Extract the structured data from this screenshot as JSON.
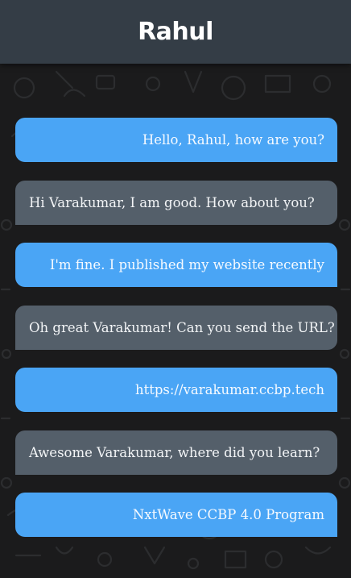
{
  "header": {
    "title": "Rahul"
  },
  "messages": [
    {
      "side": "sent",
      "text": "Hello, Rahul, how are you?"
    },
    {
      "side": "received",
      "text": "Hi Varakumar, I am good. How about you?"
    },
    {
      "side": "sent",
      "text": "I'm fine. I published my website recently"
    },
    {
      "side": "received",
      "text": "Oh great Varakumar! Can you send the URL?"
    },
    {
      "side": "sent",
      "text": "https://varakumar.ccbp.tech"
    },
    {
      "side": "received",
      "text": "Awesome Varakumar, where did you learn?"
    },
    {
      "side": "sent",
      "text": "NxtWave CCBP 4.0 Program"
    }
  ],
  "colors": {
    "header_bg": "#343d46",
    "sent_bubble": "#4aa5f5",
    "received_bubble": "#545f6a",
    "chat_bg": "#1b1b1c"
  }
}
